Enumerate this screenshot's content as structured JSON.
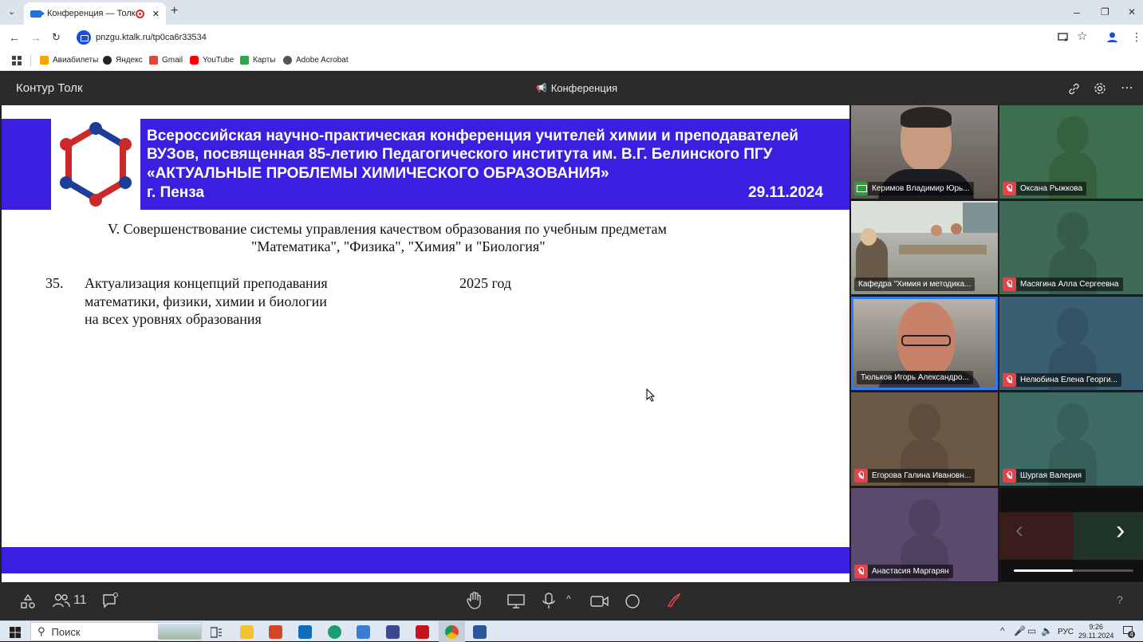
{
  "browser": {
    "tab_title": "Конференция — Толк",
    "new_tab": "+",
    "window_min": "–",
    "window_restore": "❐",
    "window_close": "✕",
    "url": "pnzgu.ktalk.ru/tp0ca6r33534",
    "bookmarks": [
      {
        "label": "Авиабилеты",
        "color": "#f7a600"
      },
      {
        "label": "Яндекс",
        "color": "#222222"
      },
      {
        "label": "Gmail",
        "color": "#ea4335"
      },
      {
        "label": "YouTube",
        "color": "#ff0000"
      },
      {
        "label": "Карты",
        "color": "#2aa84a"
      },
      {
        "label": "Adobe Acrobat",
        "color": "#555555"
      }
    ]
  },
  "app": {
    "brand": "Контур Толк",
    "title": "Конференция"
  },
  "slide": {
    "banner_line1": "Всероссийская научно-практическая конференция учителей химии и преподавателей",
    "banner_line2": "ВУЗов, посвященная 85-летию Педагогического института им. В.Г. Белинского ПГУ",
    "banner_line3": "«АКТУАЛЬНЫЕ ПРОБЛЕМЫ ХИМИЧЕСКОГО ОБРАЗОВАНИЯ»",
    "banner_city": "г. Пенза",
    "banner_date": "29.11.2024",
    "section_line1": "V. Совершенствование системы управления качеством образования по учебным предметам",
    "section_line2": "\"Математика\", \"Физика\", \"Химия\" и \"Биология\"",
    "item_number": "35.",
    "item_line1": "Актуализация концепций преподавания",
    "item_line2": "математики, физики, химии и биологии",
    "item_line3": "на всех уровнях образования",
    "item_year": "2025 год"
  },
  "participants": [
    {
      "name": "Керимов Владимир Юрь...",
      "status": "screen",
      "video": true
    },
    {
      "name": "Оксана Рыжкова",
      "status": "muted",
      "color": "#3d6e4f"
    },
    {
      "name": "Кафедра \"Химия и методика...",
      "status": "none",
      "video": true
    },
    {
      "name": "Масягина Алла Сергеевна",
      "status": "muted",
      "color": "#3f6a58"
    },
    {
      "name": "Тюльков Игорь Александро...",
      "status": "none",
      "video": true
    },
    {
      "name": "Нелюбина Елена Георги...",
      "status": "muted",
      "color": "#3a5e72"
    },
    {
      "name": "Егорова Галина Ивановн...",
      "status": "muted",
      "color": "#6b5845"
    },
    {
      "name": "Шургая Валерия",
      "status": "muted",
      "color": "#3f6b66"
    },
    {
      "name": "Анастасия Маргарян",
      "status": "muted",
      "color": "#5b4a6d"
    }
  ],
  "toolbar": {
    "participants_count": "11",
    "help": "?"
  },
  "taskbar": {
    "search": "Поиск",
    "lang": "РУС",
    "time": "9:26",
    "date": "29.11.2024",
    "notif": "4"
  }
}
